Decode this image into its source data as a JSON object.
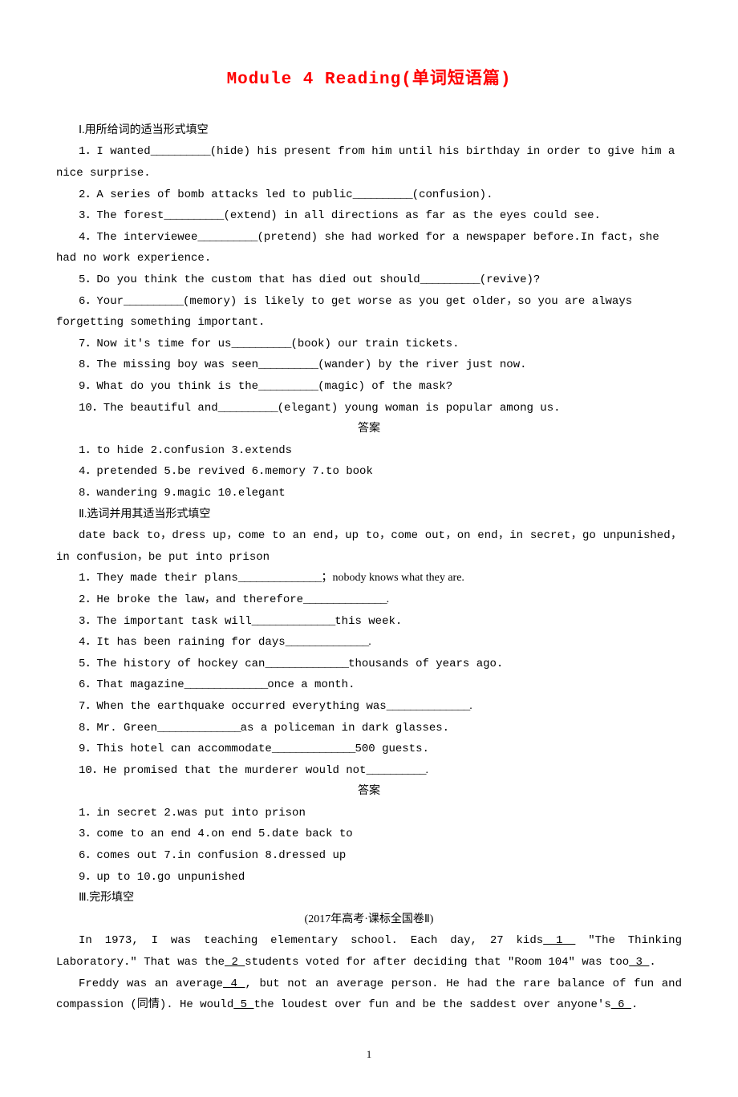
{
  "title": "Module 4  Reading(单词短语篇)",
  "sec1": {
    "head": "Ⅰ.用所给词的适当形式填空",
    "items": [
      {
        "pre": "1．I wanted",
        "hint": "(hide) his present from him until his birthday in order to give him a",
        "cont": "nice surprise."
      },
      {
        "pre": "2．A series of bomb attacks led to public",
        "hint": "(confusion)."
      },
      {
        "pre": "3．The forest",
        "hint": "(extend) in all directions as far as the eyes could see."
      },
      {
        "pre": "4．The interviewee",
        "hint": "(pretend) she had worked for a newspaper before.In fact，she",
        "cont": "had no work experience."
      },
      {
        "pre": "5．Do you think the custom that has died out should",
        "hint": "(revive)?"
      },
      {
        "pre": "6．Your",
        "hint": "(memory) is likely to get worse as you get older，so you are always",
        "cont": "forgetting something important."
      },
      {
        "pre": "7．Now it's time for us",
        "hint": "(book) our train tickets."
      },
      {
        "pre": "8．The missing boy was seen",
        "hint": "(wander) by the river just now."
      },
      {
        "pre": "9．What do you think is the",
        "hint": "(magic) of the mask?"
      },
      {
        "pre": "10．The beautiful and",
        "hint": "(elegant) young woman is popular among us."
      }
    ],
    "ansHead": "答案",
    "ans": [
      "1．to hide  2.confusion  3.extends",
      "4．pretended  5.be revived  6.memory  7.to book",
      "8．wandering  9.magic  10.elegant"
    ]
  },
  "sec2": {
    "head": "Ⅱ.选词并用其适当形式填空",
    "wordbank": "date back to，dress up，come to an end，up to，come out，on end，in secret，go unpunished，in confusion，be put into prison",
    "items": [
      {
        "pre": "1．They made their plans",
        "tail": "；nobody knows what they are."
      },
      {
        "pre": "2．He broke the law，and therefore",
        "tail": "."
      },
      {
        "pre": "3．The important task will",
        "tail": "this week."
      },
      {
        "pre": "4．It has been raining for days",
        "tail": "."
      },
      {
        "pre": "5．The history of hockey can",
        "tail": "thousands of years ago."
      },
      {
        "pre": "6．That magazine",
        "tail": "once a month."
      },
      {
        "pre": "7．When the earthquake occurred everything was",
        "tail": "."
      },
      {
        "pre": "8．Mr. Green",
        "tail": "as a policeman in dark glasses."
      },
      {
        "pre": "9．This hotel can accommodate",
        "tail": "500 guests."
      },
      {
        "pre": "10．He promised that the murderer would not",
        "tail": "."
      }
    ],
    "ansHead": "答案",
    "ans": [
      "1．in secret  2.was put into prison",
      "3．come to an end  4.on end  5.date back to",
      "6．comes out  7.in confusion  8.dressed up",
      "9．up to  10.go unpunished"
    ]
  },
  "sec3": {
    "head": "Ⅲ.完形填空",
    "src": "(2017年高考·课标全国卷Ⅱ)",
    "p1": {
      "a": "In 1973, I was teaching elementary school. Each day, 27 kids",
      "b": " 1 ",
      "c": " \"The Thinking Laboratory.\" That was the",
      "d": " 2 ",
      "e": "students voted for after deciding that \"Room 104\" was too",
      "f": " 3 ",
      "g": "."
    },
    "p2": {
      "a": "Freddy was an average",
      "b": " 4 ",
      "c": ",  but not an average person. He had the rare balance of fun and compassion (同情). He would",
      "d": " 5 ",
      "e": "the loudest over fun and be the saddest over anyone's",
      "f": " 6 ",
      "g": "."
    }
  },
  "pagenum": "1"
}
